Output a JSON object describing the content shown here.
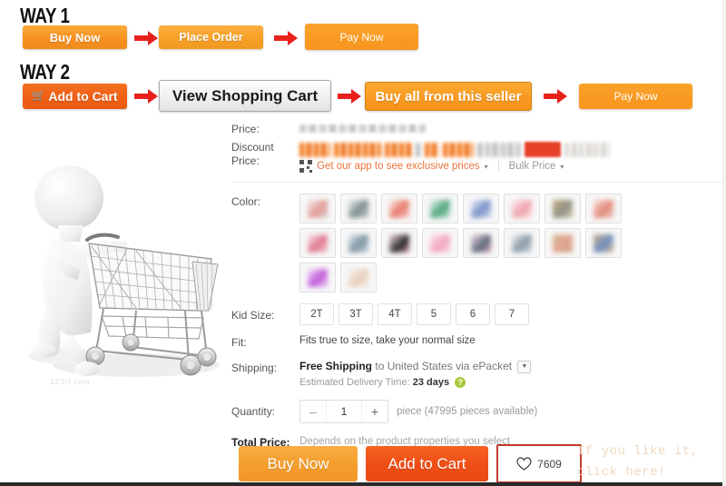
{
  "flow": {
    "way1_label": "WAY 1",
    "way2_label": "WAY 2",
    "way1_steps": [
      "Buy Now",
      "Place Order",
      "Pay Now"
    ],
    "way2_steps": [
      "Add to Cart",
      "View Shopping Cart",
      "Buy all from this seller",
      "Pay Now"
    ],
    "cart_icon": "shopping-cart-icon",
    "arrow_icon": "right-arrow-icon",
    "arrow_color": "#e8211c"
  },
  "product_image": {
    "alt": "3d-figure-pushing-shopping-cart",
    "watermark": "123rf.com"
  },
  "detail": {
    "price": {
      "label": "Price:",
      "value_redacted": true
    },
    "discount_price": {
      "label": "Discount Price:",
      "value_redacted": true,
      "badge_color": "#e8412a"
    },
    "app_promo": {
      "icon": "qr-code-icon",
      "text": "Get our app to see exclusive prices",
      "caret": "▾",
      "color": "#e8733a"
    },
    "bulk_price": {
      "text": "Bulk Price",
      "caret": "▾"
    },
    "color": {
      "label": "Color:",
      "swatch_count": 18,
      "swatches_redacted": true
    },
    "kid_size": {
      "label": "Kid Size:",
      "options": [
        "2T",
        "3T",
        "4T",
        "5",
        "6",
        "7"
      ]
    },
    "fit": {
      "label": "Fit:",
      "text": "Fits true to size, take your normal size"
    },
    "shipping": {
      "label": "Shipping:",
      "free_text": "Free Shipping",
      "rest_text": "to United States via ePacket",
      "select_icon": "chevron-down-icon",
      "eta_label": "Estimated Delivery Time:",
      "eta_value": "23 days",
      "help_icon": "question-mark-icon",
      "help_color": "#a8c83c"
    },
    "quantity": {
      "label": "Quantity:",
      "minus": "–",
      "value": "1",
      "plus": "+",
      "note": "piece (47995 pieces available)"
    },
    "total_price": {
      "label": "Total Price:",
      "text": "Depends on the product properties you select"
    }
  },
  "actions": {
    "buy_now": "Buy Now",
    "add_to_cart": "Add to Cart",
    "favorite_icon": "heart-icon",
    "favorite_count": "7609",
    "favorite_border_color": "#c0392b",
    "hint_line1": "If you like it,",
    "hint_line2": "click here!",
    "hint_color": "#f0d8c2"
  }
}
